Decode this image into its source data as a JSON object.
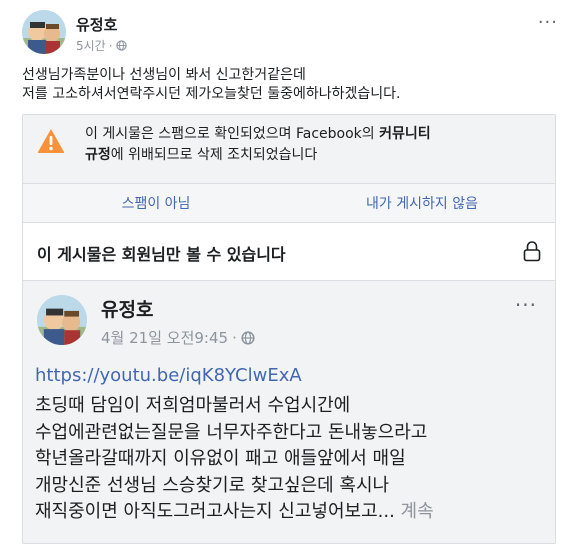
{
  "post": {
    "author": "유정호",
    "time": "5시간",
    "dot": "·",
    "more": "···",
    "text_lines": [
      "선생님가족분이나 선생님이 봐서 신고한거같은데",
      "저를 고소하셔서연락주시던 제가오늘찾던 둘중에하나하겠습니다."
    ]
  },
  "notice": {
    "part1": "이 게시물은 스팸으로 확인되었으며 Facebook의 ",
    "bold1": "커뮤니티",
    "bold2": "규정",
    "part2": "에 위배되므로 삭제 조치되었습니다",
    "not_spam": "스팸이 아님",
    "not_mine": "내가 게시하지 않음",
    "members_only": "이 게시물은 회원님만 볼 수 있습니다"
  },
  "shared": {
    "author": "유정호",
    "date": "4월 21일 오전9:45",
    "dot": "·",
    "more": "···",
    "link": "https://youtu.be/iqK8YClwExA",
    "lines": [
      "초딩때 담임이 저희엄마불러서 수업시간에",
      "수업에관련없는질문을 너무자주한다고 돈내놓으라고",
      "학년올라갈때까지 이유없이 패고 애들앞에서 매일",
      "개망신준 선생님 스승찾기로 찾고싶은데 혹시나",
      "재직중이면 아직도그러고사는지 신고넣어보고..."
    ],
    "see_more": "계속"
  },
  "icons": {
    "globe": "globe-icon",
    "warning": "warning-icon",
    "lock": "lock-icon"
  },
  "colors": {
    "link": "#4267b2",
    "warning": "#f7923b",
    "muted": "#8d949e"
  }
}
